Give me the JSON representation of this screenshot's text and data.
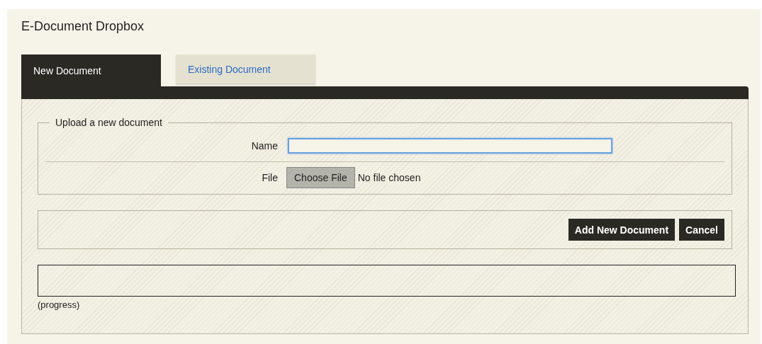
{
  "dialog": {
    "title": "E-Document Dropbox"
  },
  "tabs": [
    {
      "label": "New Document",
      "selected": true
    },
    {
      "label": "Existing Document",
      "selected": false
    }
  ],
  "upload": {
    "legend": "Upload a new document",
    "name_field": {
      "label": "Name",
      "focused": true
    },
    "file_field": {
      "label": "File",
      "button": "Choose File",
      "status": "No file chosen"
    }
  },
  "actions": [
    {
      "label": "Add New Document"
    },
    {
      "label": "Cancel"
    }
  ],
  "progress": {
    "level": 0,
    "label": "(progress)"
  }
}
